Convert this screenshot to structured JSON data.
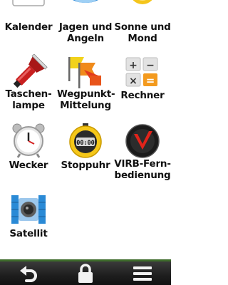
{
  "apps": {
    "kalender": {
      "label": "Kalender"
    },
    "jagen": {
      "label": "Jagen und\nAngeln"
    },
    "sonne": {
      "label": "Sonne und\nMond"
    },
    "taschenlampe": {
      "label": "Taschen-\nlampe"
    },
    "wegpunkt": {
      "label": "Wegpunkt-\nMittelung"
    },
    "rechner": {
      "label": "Rechner"
    },
    "wecker": {
      "label": "Wecker"
    },
    "stoppuhr": {
      "label": "Stoppuhr",
      "display": "00:00"
    },
    "virb": {
      "label": "VIRB-Fern-\nbedienung"
    },
    "satellit": {
      "label": "Satellit"
    }
  },
  "calculator_icon": {
    "plus": "+",
    "minus": "−",
    "times": "×",
    "equals": "="
  },
  "bottom_bar": {
    "back_icon": "back-arrow-icon",
    "lock_icon": "lock-icon",
    "menu_icon": "menu-icon"
  },
  "colors": {
    "accent_green": "#3d6b2a",
    "bar_dark": "#1e1e1e"
  }
}
